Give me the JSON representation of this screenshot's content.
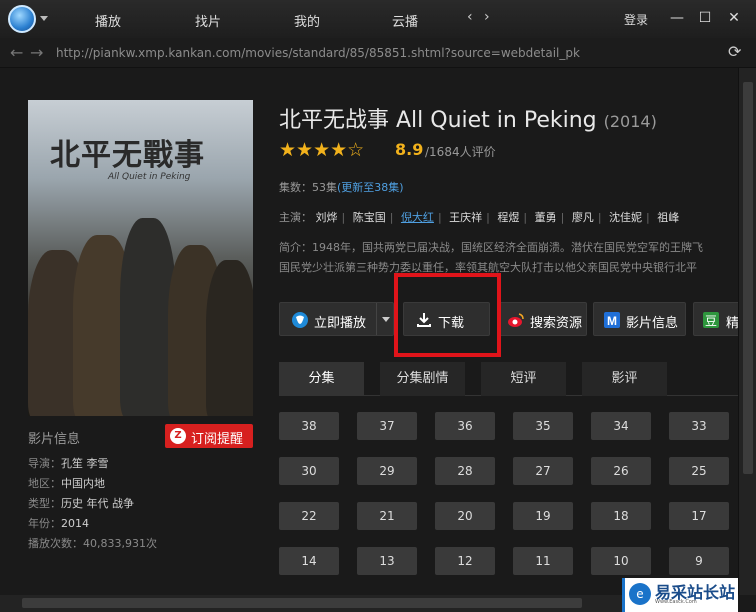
{
  "nav": {
    "items": [
      "播放",
      "找片",
      "我的",
      "云播"
    ],
    "login": "登录"
  },
  "address": {
    "url": "http://piankw.xmp.kankan.com/movies/standard/85/85851.shtml?source=webdetail_pk"
  },
  "poster": {
    "title": "北平无戰事",
    "subtitle": "All Quiet in Peking"
  },
  "left_info": {
    "heading": "影片信息",
    "subscribe": "订阅提醒",
    "rows": [
      {
        "label": "导演：",
        "value": "孔笙 李雪"
      },
      {
        "label": "地区：",
        "value": "中国内地"
      },
      {
        "label": "类型：",
        "value": "历史 年代 战争"
      },
      {
        "label": "年份：",
        "value": "2014"
      },
      {
        "label": "播放次数：",
        "value": "40,833,931次"
      }
    ]
  },
  "movie": {
    "title": "北平无战事 All Quiet in Peking",
    "year": "(2014)",
    "score": "8.9",
    "rating_count": "/1684人评价",
    "episodes_label": "集数：53集",
    "episodes_update": "(更新至38集)",
    "cast_label": "主演：",
    "cast": [
      "刘烨",
      "陈宝国",
      "倪大红",
      "王庆祥",
      "程煜",
      "董勇",
      "廖凡",
      "沈佳妮",
      "祖峰"
    ],
    "synopsis_line1": "简介：1948年，国共两党已届决战，国统区经济全面崩溃。潜伏在国民党空军的王牌飞",
    "synopsis_line2": "国民党少壮派第三种势力委以重任，率领其航空大队打击以他父亲国民党中央银行北平"
  },
  "actions": {
    "play": "立即播放",
    "download": "下载",
    "search": "搜索资源",
    "info": "影片信息",
    "douban": "精"
  },
  "tabs": [
    "分集",
    "分集剧情",
    "短评",
    "影评"
  ],
  "episodes": [
    [
      "38",
      "37",
      "36",
      "35",
      "34",
      "33"
    ],
    [
      "30",
      "29",
      "28",
      "27",
      "26",
      "25"
    ],
    [
      "22",
      "21",
      "20",
      "19",
      "18",
      "17"
    ],
    [
      "14",
      "13",
      "12",
      "11",
      "10",
      "9"
    ]
  ],
  "watermark": {
    "title": "易采站长站",
    "sub": "Www.Easck.Com"
  },
  "colors": {
    "accent": "#f2b21c",
    "link": "#4f9fe0",
    "highlight": "#e0141a"
  }
}
